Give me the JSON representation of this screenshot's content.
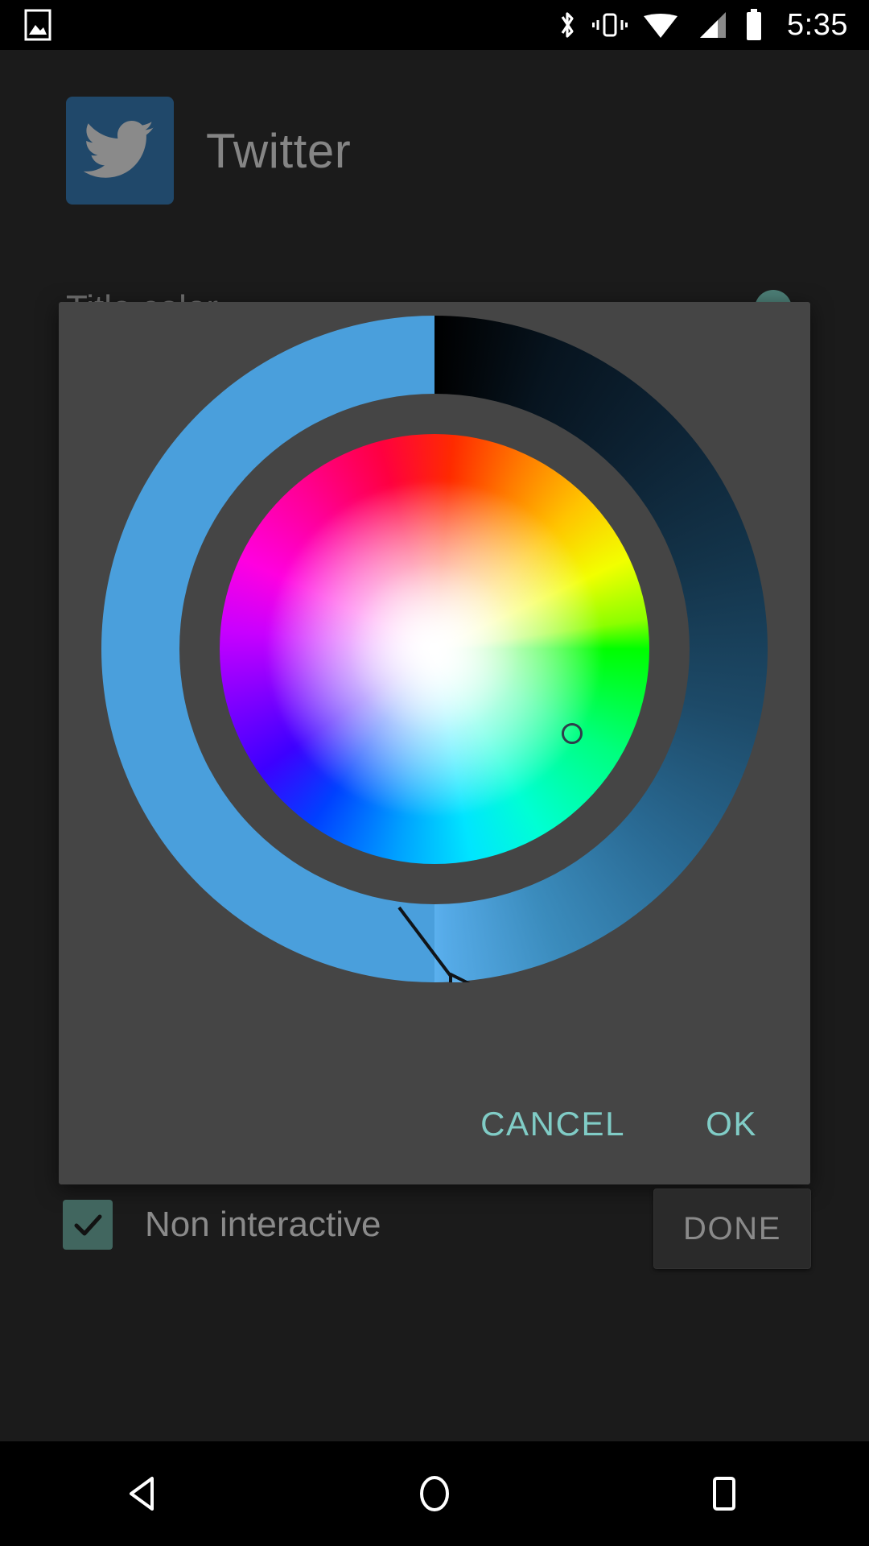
{
  "statusbar": {
    "time": "5:35",
    "icons": [
      "screenshot-icon",
      "bluetooth-icon",
      "vibrate-icon",
      "wifi-icon",
      "signal-icon",
      "battery-icon"
    ]
  },
  "app_header": {
    "title": "Twitter",
    "icon_name": "twitter-bird-icon",
    "icon_bg": "#20486a"
  },
  "background_row": {
    "label": "Title color",
    "swatch_color": "#4d7f77"
  },
  "dialog": {
    "background": "#454545",
    "color_picker": {
      "selected_color": "#4a9fdc",
      "ring_label": "value-ring",
      "wheel_label": "hue-saturation-wheel",
      "cursor_label": "saturation-cursor",
      "pointer_label": "value-pointer"
    },
    "buttons": {
      "cancel": "CANCEL",
      "ok": "OK",
      "accent": "#80ccc6"
    }
  },
  "footer": {
    "checkbox": {
      "label": "Non interactive",
      "checked": true,
      "fill": "#41665f"
    },
    "done_button": "DONE"
  },
  "navbar": {
    "back": "back-icon",
    "home": "home-icon",
    "recents": "recents-icon"
  }
}
